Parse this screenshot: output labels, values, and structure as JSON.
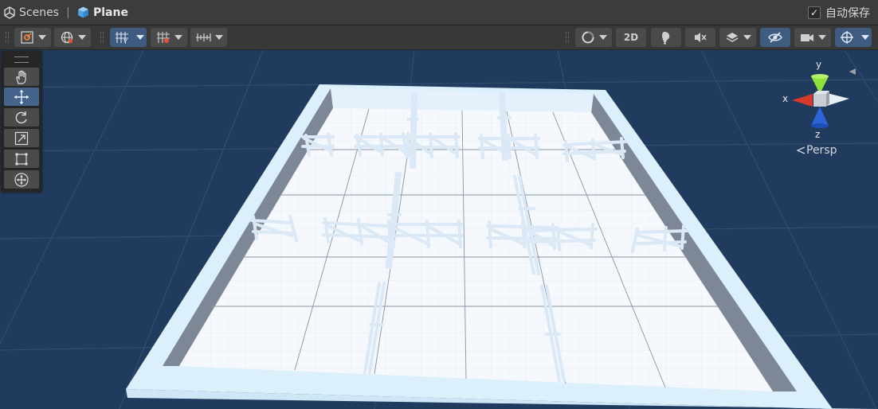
{
  "breadcrumb": {
    "root": "Scenes",
    "separator": "|",
    "current": "Plane"
  },
  "autosave": {
    "label": "自动保存",
    "checked": true
  },
  "toolbar": {
    "left": [
      {
        "id": "gizmo-tools",
        "icon": "transform-pivot-icon"
      },
      {
        "id": "global-toggle",
        "icon": "globe-icon"
      },
      {
        "id": "grid-snap",
        "icon": "grid-snap-icon",
        "active": true
      },
      {
        "id": "increment-snap",
        "icon": "increment-snap-icon"
      },
      {
        "id": "snap-settings",
        "icon": "ruler-icon"
      }
    ],
    "right": {
      "shading": "shading-mode-icon",
      "mode_2d": "2D",
      "lighting": "lighting-icon",
      "audio": "audio-mute-icon",
      "effects": "effects-icon",
      "visibility": "hidden-eye-icon",
      "camera": "camera-icon",
      "gizmos": "gizmos-icon"
    }
  },
  "tools": [
    {
      "id": "hand",
      "icon": "hand-icon"
    },
    {
      "id": "move",
      "icon": "move-icon",
      "active": true
    },
    {
      "id": "rotate",
      "icon": "rotate-icon"
    },
    {
      "id": "scale",
      "icon": "scale-icon"
    },
    {
      "id": "rect",
      "icon": "rect-transform-icon"
    },
    {
      "id": "transform",
      "icon": "transform-icon"
    }
  ],
  "gizmo": {
    "x_label": "x",
    "y_label": "y",
    "z_label": "z",
    "projection": "Persp"
  },
  "colors": {
    "viewport_bg": "#203b5e",
    "floor": "#f4f8fc",
    "wall_light": "#dcecfb",
    "wall_dark": "#7f8896",
    "axis_x": "#d83a2a",
    "axis_y": "#9be33a",
    "axis_z": "#2f64d8",
    "active": "#3f5b80"
  }
}
